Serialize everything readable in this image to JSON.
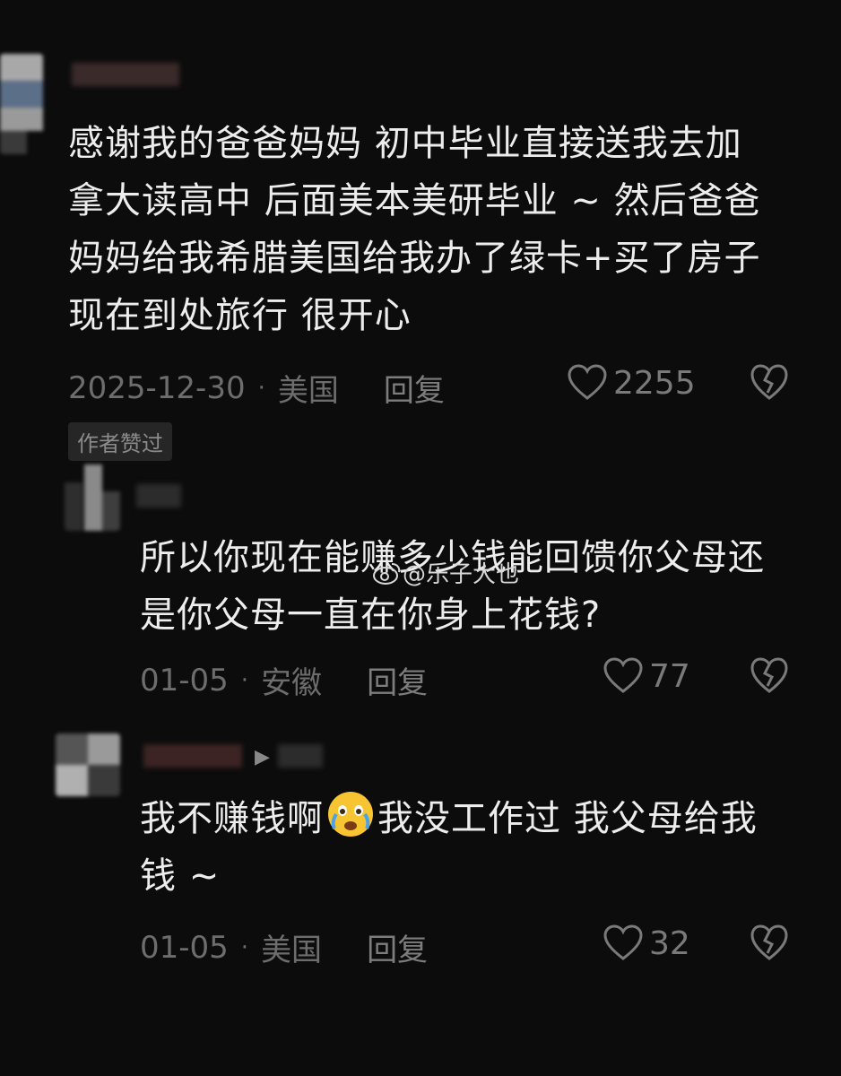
{
  "comments": [
    {
      "lines": [
        "感谢我的爸爸妈妈 初中毕业直接送我去加",
        "拿大读高中 后面美本美研毕业 ~ 然后爸爸",
        "妈妈给我希腊美国给我办了绿卡+买了房子",
        "现在到处旅行 很开心"
      ],
      "date": "2025-12-30",
      "location": "美国",
      "reply_label": "回复",
      "likes": "2255",
      "badge": "作者赞过"
    },
    {
      "lines": [
        "所以你现在能赚多少钱能回馈你父母还",
        "是你父母一直在你身上花钱?"
      ],
      "date": "01-05",
      "location": "安徽",
      "reply_label": "回复",
      "likes": "77"
    },
    {
      "line1_a": "我不赚钱啊",
      "line1_b": "我没工作过 我父母给我",
      "line2": "钱 ~",
      "date": "01-05",
      "location": "美国",
      "reply_label": "回复",
      "likes": "32"
    }
  ],
  "watermark": {
    "text": "@乐子大也",
    "icon": "weibo-icon"
  },
  "icons": {
    "like": "heart-outline-icon",
    "dislike": "broken-heart-icon",
    "emoji": "crying-laughing-emoji"
  }
}
